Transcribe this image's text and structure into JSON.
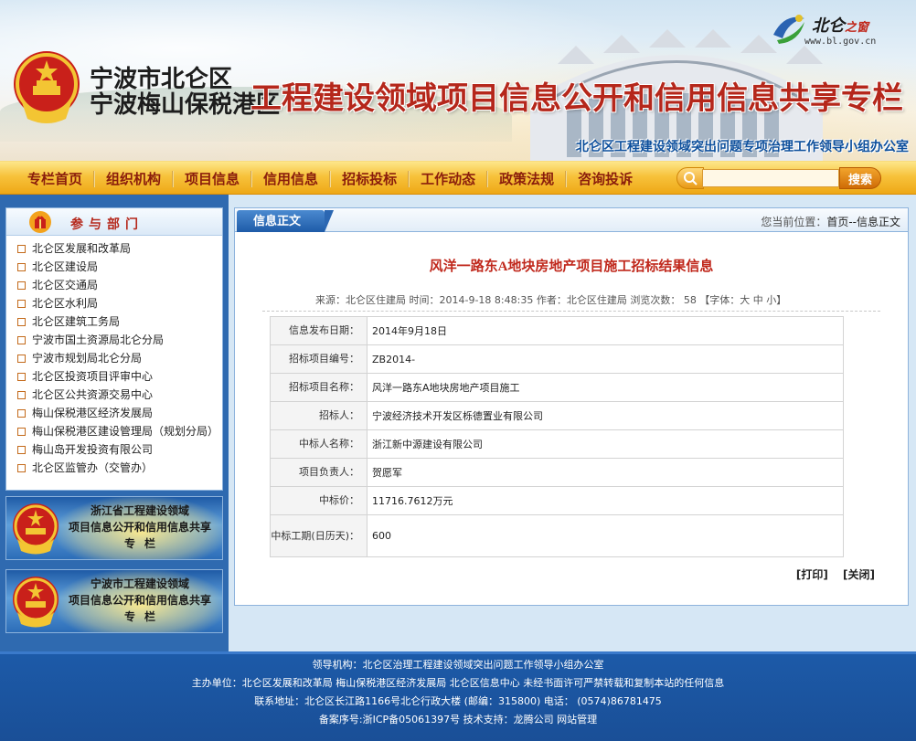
{
  "header": {
    "logo_brand": "北仑",
    "logo_accent": "之窗",
    "logo_url": "www.bl.gov.cn",
    "city_line1": "宁波市北仑区",
    "city_line2": "宁波梅山保税港区",
    "banner_title": "工程建设领域项目信息公开和信用信息共享专栏",
    "sub_office": "北仑区工程建设领域突出问题专项治理工作领导小组办公室"
  },
  "nav": {
    "items": [
      "专栏首页",
      "组织机构",
      "项目信息",
      "信用信息",
      "招标投标",
      "工作动态",
      "政策法规",
      "咨询投诉"
    ],
    "search_placeholder": "",
    "search_button": "搜索"
  },
  "sidebar": {
    "title": "参与部门",
    "departments": [
      "北仑区发展和改革局",
      "北仑区建设局",
      "北仑区交通局",
      "北仑区水利局",
      "北仑区建筑工务局",
      "宁波市国土资源局北仑分局",
      "宁波市规划局北仑分局",
      "北仑区投资项目评审中心",
      "北仑区公共资源交易中心",
      "梅山保税港区经济发展局",
      "梅山保税港区建设管理局（规划分局）",
      "梅山岛开发投资有限公司",
      "北仑区监管办（交管办）"
    ],
    "promos": [
      {
        "line1": "浙江省工程建设领域",
        "line2": "项目信息公开和信用信息共享",
        "line3": "专栏"
      },
      {
        "line1": "宁波市工程建设领域",
        "line2": "项目信息公开和信用信息共享",
        "line3": "专栏"
      }
    ]
  },
  "content": {
    "tab_label": "信息正文",
    "location_label": "您当前位置：",
    "location_crumb": "首页--信息正文",
    "title": "风洋一路东A地块房地产项目施工招标结果信息",
    "meta": "来源：北仑区住建局 时间：2014-9-18 8:48:35 作者：北仑区住建局 浏览次数： 58 【字体：大 中 小】",
    "rows": [
      {
        "key": "信息发布日期：",
        "value": "2014年9月18日"
      },
      {
        "key": "招标项目编号：",
        "value": "ZB2014-"
      },
      {
        "key": "招标项目名称：",
        "value": "风洋一路东A地块房地产项目施工"
      },
      {
        "key": "招标人：",
        "value": "宁波经济技术开发区栎德置业有限公司"
      },
      {
        "key": "中标人名称：",
        "value": "浙江新中源建设有限公司"
      },
      {
        "key": "项目负责人：",
        "value": "贺愿军"
      },
      {
        "key": "中标价：",
        "value": "11716.7612万元"
      },
      {
        "key": "中标工期(日历天)：",
        "value": "600"
      }
    ],
    "print_label": "[打印]",
    "close_label": "[关闭]"
  },
  "footer": {
    "line1": "领导机构：北仑区治理工程建设领域突出问题工作领导小组办公室",
    "line2": "主办单位：北仑区发展和改革局   梅山保税港区经济发展局   北仑区信息中心   未经书面许可严禁转载和复制本站的任何信息",
    "line3": "联系地址：北仑区长江路1166号北仑行政大楼 (邮编：315800)  电话： (0574)86781475",
    "line4": "备案序号:浙ICP备05061397号 技术支持：龙腾公司      网站管理"
  },
  "colors": {
    "brand_red": "#b5271b",
    "nav_gold": "#f7c23c",
    "primary_blue": "#1e5ba8"
  }
}
